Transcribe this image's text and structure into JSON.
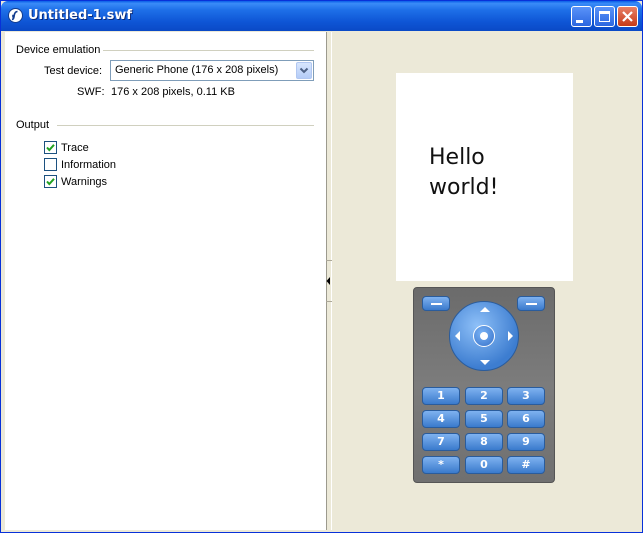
{
  "window": {
    "title": "Untitled-1.swf",
    "accent_color": "#0A5EE8"
  },
  "device_emulation": {
    "group_title": "Device emulation",
    "test_device_label": "Test device:",
    "test_device_value": "Generic Phone (176 x 208 pixels)",
    "swf_label": "SWF:",
    "swf_value": "176 x 208 pixels, 0.11 KB"
  },
  "output": {
    "group_title": "Output",
    "options": [
      {
        "label": "Trace",
        "checked": true
      },
      {
        "label": "Information",
        "checked": false
      },
      {
        "label": "Warnings",
        "checked": true
      }
    ]
  },
  "phone": {
    "screen_text": "Hello\nworld!",
    "keys": [
      [
        "1",
        "2",
        "3"
      ],
      [
        "4",
        "5",
        "6"
      ],
      [
        "7",
        "8",
        "9"
      ],
      [
        "*",
        "0",
        "#"
      ]
    ]
  },
  "icons": {
    "app": "flash-icon",
    "minimize": "minimize-icon",
    "maximize": "maximize-icon",
    "close": "close-icon",
    "dropdown": "chevron-down-icon",
    "splitter": "collapse-arrow-icon"
  }
}
